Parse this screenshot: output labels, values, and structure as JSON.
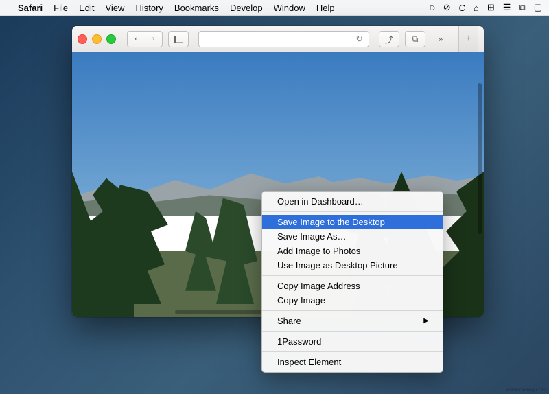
{
  "menubar": {
    "app": "Safari",
    "items": [
      "File",
      "Edit",
      "View",
      "History",
      "Bookmarks",
      "Develop",
      "Window",
      "Help"
    ],
    "extras": [
      "dropbox-icon",
      "noscript-icon",
      "refresh-icon",
      "home-icon",
      "grid-icon",
      "menu-icon",
      "wifi-icon",
      "airplay-icon"
    ]
  },
  "toolbar": {
    "back": "‹",
    "forward": "›",
    "reload": "↻",
    "share": "⤴",
    "tabs_overview": "⧉",
    "more": "»",
    "newtab": "+"
  },
  "context_menu": {
    "items": [
      {
        "label": "Open in Dashboard…",
        "selected": false,
        "submenu": false
      },
      {
        "separator": true
      },
      {
        "label": "Save Image to the Desktop",
        "selected": true,
        "submenu": false
      },
      {
        "label": "Save Image As…",
        "selected": false,
        "submenu": false
      },
      {
        "label": "Add Image to Photos",
        "selected": false,
        "submenu": false
      },
      {
        "label": "Use Image as Desktop Picture",
        "selected": false,
        "submenu": false
      },
      {
        "separator": true
      },
      {
        "label": "Copy Image Address",
        "selected": false,
        "submenu": false
      },
      {
        "label": "Copy Image",
        "selected": false,
        "submenu": false
      },
      {
        "separator": true
      },
      {
        "label": "Share",
        "selected": false,
        "submenu": true
      },
      {
        "separator": true
      },
      {
        "label": "1Password",
        "selected": false,
        "submenu": false
      },
      {
        "separator": true
      },
      {
        "label": "Inspect Element",
        "selected": false,
        "submenu": false
      }
    ]
  },
  "watermark": "www.desaq.com"
}
